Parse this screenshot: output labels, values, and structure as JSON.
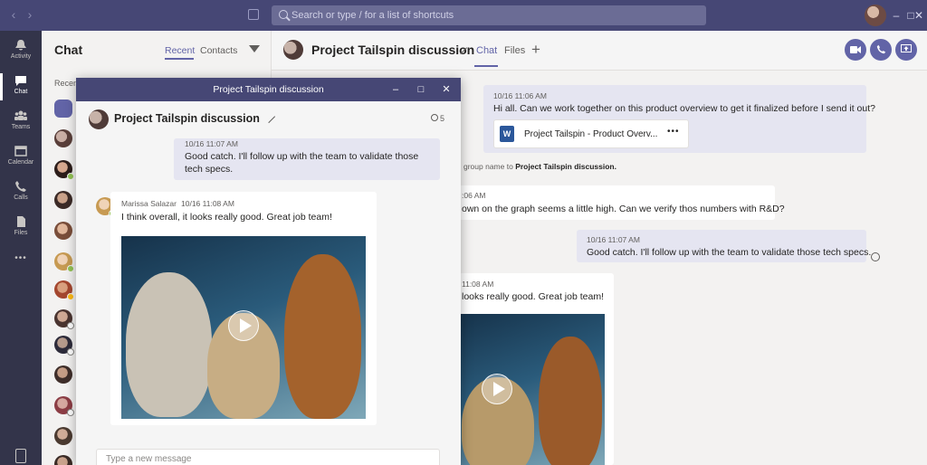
{
  "titlebar": {
    "search_placeholder": "Search or type / for a list of shortcuts",
    "back_icon": "chevron-left-icon",
    "forward_icon": "chevron-right-icon",
    "minimize": "–",
    "maximize": "□",
    "close": "✕"
  },
  "appbar": {
    "items": [
      {
        "label": "Activity",
        "icon": "bell-icon"
      },
      {
        "label": "Chat",
        "icon": "chat-icon"
      },
      {
        "label": "Teams",
        "icon": "teams-icon"
      },
      {
        "label": "Calendar",
        "icon": "calendar-icon"
      },
      {
        "label": "Calls",
        "icon": "phone-icon"
      },
      {
        "label": "Files",
        "icon": "files-icon"
      }
    ],
    "more": "•••"
  },
  "chat_list": {
    "title": "Chat",
    "tabs": [
      "Recent",
      "Contacts"
    ],
    "recent_label": "Recen"
  },
  "conversation": {
    "title": "Project Tailspin discussion",
    "tabs": [
      "Chat",
      "Files"
    ],
    "add_tab": "+",
    "messages": {
      "m1_meta": "10/16 11:06 AM",
      "m1_text": "Hi all.  Can we work together on this product overview to get it finalized before I send it out?",
      "file_name": "Project Tailspin - Product Overv...",
      "file_more": "•••",
      "sys_pre": "group name to ",
      "sys_bold": "Project Tailspin discussion.",
      "m2_meta": ":06 AM",
      "m2_text": "own on the graph seems a little high.  Can we verify thos numbers with R&D?",
      "m3_meta": "10/16 11:07 AM",
      "m3_text": "Good catch.  I'll follow up with the team to validate those tech specs.",
      "m4_meta": "11:08 AM",
      "m4_text": "looks really good.  Great job team!"
    }
  },
  "popout": {
    "window_title": "Project Tailspin discussion",
    "title": "Project Tailspin discussion",
    "participants": "5",
    "msg1_meta": "10/16 11:07 AM",
    "msg1_text": "Good catch.  I'll follow up with the team to validate those tech specs.",
    "msg2_author": "Marissa Salazar",
    "msg2_time": "10/16 11:08 AM",
    "msg2_text": "I think overall, it looks really good.  Great job team!",
    "compose_placeholder": "Type a new message"
  }
}
